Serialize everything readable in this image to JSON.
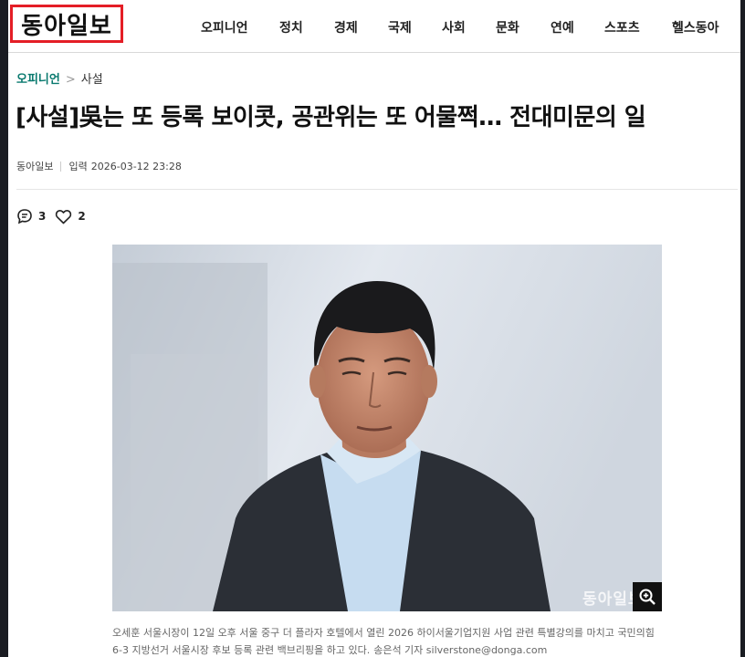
{
  "header": {
    "logo_text": "동아일보",
    "nav": [
      "오피니언",
      "정치",
      "경제",
      "국제",
      "사회",
      "문화",
      "연예",
      "스포츠",
      "헬스동아"
    ]
  },
  "breadcrumb": {
    "section": "오피니언",
    "subsection": "사설"
  },
  "article": {
    "title": "[사설]吳는 또 등록 보이콧, 공관위는 또 어물쩍… 전대미문의 일",
    "source": "동아일보",
    "date_label": "입력",
    "date": "2026-03-12 23:28",
    "comment_count": "3",
    "like_count": "2"
  },
  "photo": {
    "watermark": "동아일보",
    "caption": "오세훈 서울시장이 12일 오후 서울 중구 더 플라자 호텔에서 열린 2026 하이서울기업지원 사업 관련 특별강의를 마치고 국민의힘 6-3 지방선거 서울시장 후보 등록 관련 백브리핑을 하고 있다.",
    "credit": "송은석 기자 silverstone@donga.com"
  },
  "colors": {
    "logo_border": "#e41e26",
    "section_accent": "#0a7a6f"
  }
}
